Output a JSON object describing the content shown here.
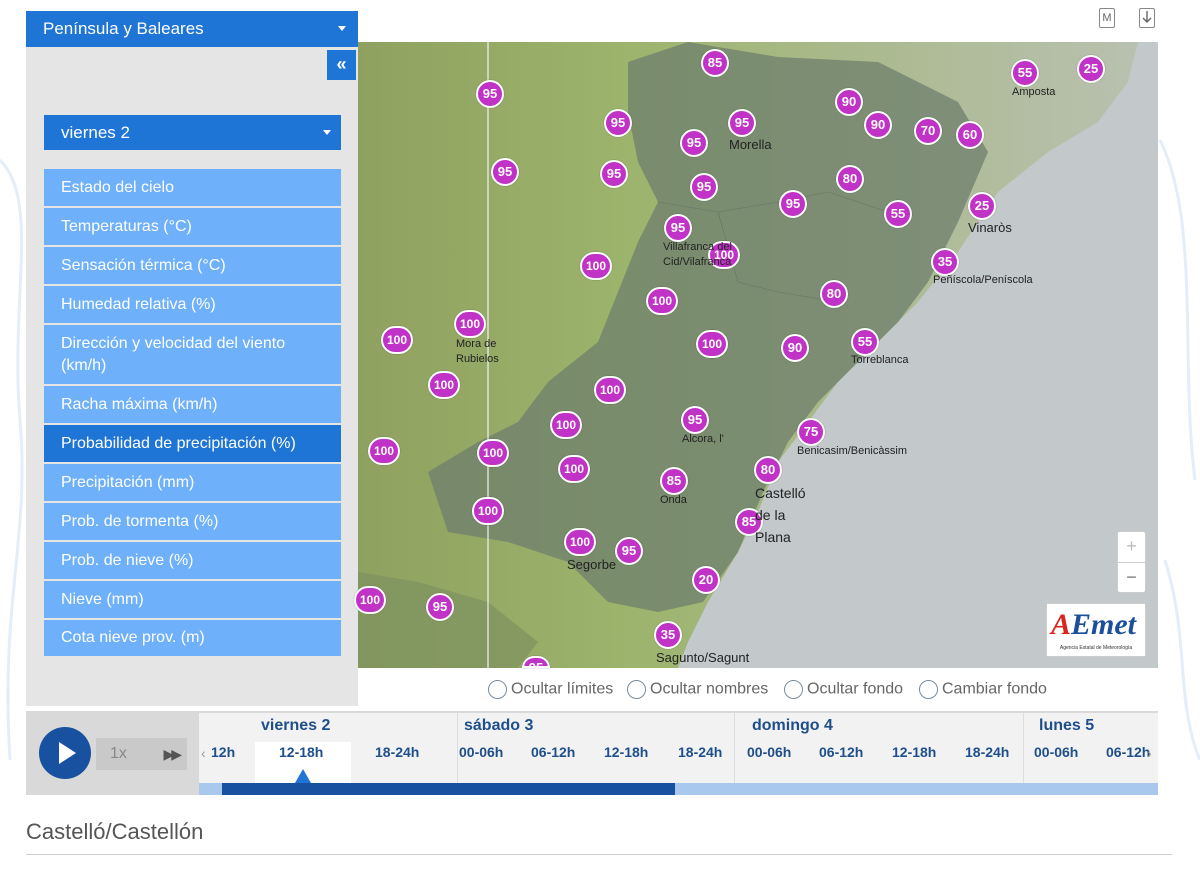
{
  "header": {
    "region_select": "Península y Baleares",
    "collapse_label": "«",
    "icon_map_label": "M"
  },
  "sidebar": {
    "day_select": "viernes 2",
    "items": [
      {
        "label": "Estado del cielo",
        "active": false
      },
      {
        "label": "Temperaturas (°C)",
        "active": false
      },
      {
        "label": "Sensación térmica (°C)",
        "active": false
      },
      {
        "label": "Humedad relativa (%)",
        "active": false
      },
      {
        "label": "Dirección y velocidad del viento (km/h)",
        "active": false
      },
      {
        "label": "Racha máxima (km/h)",
        "active": false
      },
      {
        "label": "Probabilidad de precipitación (%)",
        "active": true
      },
      {
        "label": "Precipitación (mm)",
        "active": false
      },
      {
        "label": "Prob. de tormenta (%)",
        "active": false
      },
      {
        "label": "Prob. de nieve (%)",
        "active": false
      },
      {
        "label": "Nieve (mm)",
        "active": false
      },
      {
        "label": "Cota nieve prov. (m)",
        "active": false
      }
    ]
  },
  "map": {
    "badge_color": "#c133c6",
    "values": [
      "85",
      "95",
      "95",
      "95",
      "95",
      "90",
      "90",
      "70",
      "60",
      "55",
      "25",
      "95",
      "95",
      "95",
      "95",
      "80",
      "55",
      "25",
      "95",
      "100",
      "35",
      "100",
      "100",
      "80",
      "100",
      "100",
      "100",
      "100",
      "90",
      "55",
      "100",
      "100",
      "95",
      "75",
      "100",
      "100",
      "100",
      "85",
      "80",
      "100",
      "85",
      "100",
      "95",
      "20",
      "100",
      "95",
      "35",
      "95"
    ],
    "towns": [
      "Amposta",
      "Morella",
      "Vinaròs",
      "Villafranca del Cid/Vilafranca",
      "Peñíscola/Peníscola",
      "Mora de Rubielos",
      "Torreblanca",
      "Alcora, l'",
      "Benicasim/Benicàssim",
      "Onda",
      "Castelló de la Plana",
      "Segorbe",
      "Sagunto/Sagunt"
    ],
    "zoom_in": "+",
    "zoom_out": "−",
    "logo_brand": "AEmet",
    "logo_sub": "Agencia Estatal de Meteorología"
  },
  "options": [
    "Ocultar límites",
    "Ocultar nombres",
    "Ocultar fondo",
    "Cambiar fondo"
  ],
  "timeline": {
    "speed": "1x",
    "days": [
      "viernes 2",
      "sábado 3",
      "domingo 4",
      "lunes 5"
    ],
    "slots": [
      "12h",
      "12-18h",
      "18-24h",
      "00-06h",
      "06-12h",
      "12-18h",
      "18-24h",
      "00-06h",
      "06-12h",
      "12-18h",
      "18-24h",
      "00-06h",
      "06-12h"
    ],
    "selected_slot": "12-18h",
    "progress": 0.5,
    "fill_color": "#1751a0"
  },
  "location": {
    "title": "Castelló/Castellón"
  }
}
